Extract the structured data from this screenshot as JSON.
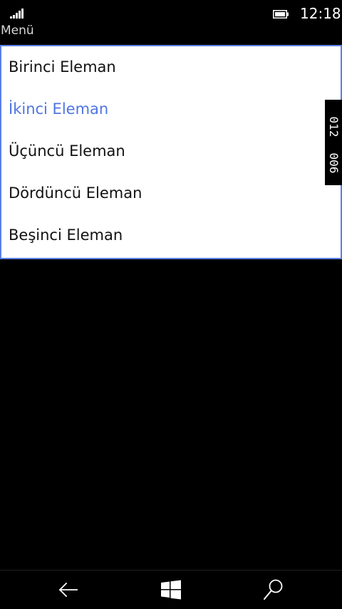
{
  "status_bar": {
    "time": "12:18",
    "signal_icon": "signal-bars-icon",
    "battery_icon": "battery-icon"
  },
  "app": {
    "title": "Menü"
  },
  "list": {
    "items": [
      {
        "label": "Birinci Eleman",
        "selected": false
      },
      {
        "label": "İkinci Eleman",
        "selected": true
      },
      {
        "label": "Üçüncü Eleman",
        "selected": false
      },
      {
        "label": "Dördüncü Eleman",
        "selected": false
      },
      {
        "label": "Beşinci Eleman",
        "selected": false
      }
    ],
    "accent_color": "#5b7fe6",
    "selected_color": "#4f74e3"
  },
  "side_counter": {
    "values": [
      "012",
      "006"
    ]
  },
  "nav_bar": {
    "back_icon": "back-arrow-icon",
    "home_icon": "windows-logo-icon",
    "search_icon": "search-icon"
  }
}
